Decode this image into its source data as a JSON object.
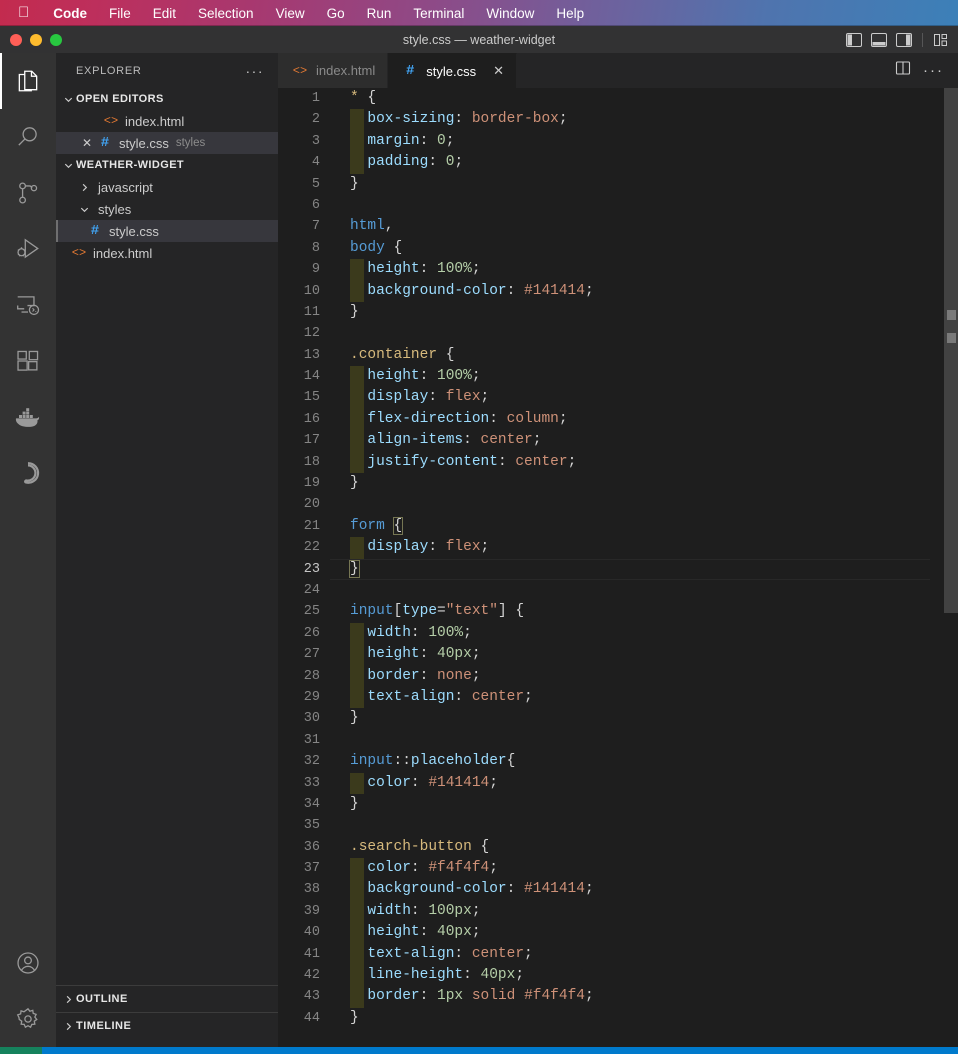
{
  "menubar": {
    "apple_logo": "",
    "items": [
      {
        "label": "Code",
        "bold": true
      },
      {
        "label": "File",
        "bold": false
      },
      {
        "label": "Edit",
        "bold": false
      },
      {
        "label": "Selection",
        "bold": false
      },
      {
        "label": "View",
        "bold": false
      },
      {
        "label": "Go",
        "bold": false
      },
      {
        "label": "Run",
        "bold": false
      },
      {
        "label": "Terminal",
        "bold": false
      },
      {
        "label": "Window",
        "bold": false
      },
      {
        "label": "Help",
        "bold": false
      }
    ]
  },
  "titlebar": {
    "title": "style.css — weather-widget",
    "layout_icons": [
      "toggle-primary-sidebar",
      "toggle-panel",
      "toggle-secondary-sidebar",
      "customize-layout"
    ]
  },
  "activitybar": {
    "items": [
      {
        "name": "explorer",
        "active": true
      },
      {
        "name": "search",
        "active": false
      },
      {
        "name": "source-control",
        "active": false
      },
      {
        "name": "run-and-debug",
        "active": false
      },
      {
        "name": "remote-explorer",
        "active": false
      },
      {
        "name": "extensions",
        "active": false
      },
      {
        "name": "docker",
        "active": false
      },
      {
        "name": "sourcery",
        "active": false
      }
    ],
    "bottom": [
      {
        "name": "accounts"
      },
      {
        "name": "manage-settings"
      }
    ]
  },
  "sidebar": {
    "header_label": "EXPLORER",
    "header_actions": "···",
    "open_editors": {
      "label": "OPEN EDITORS",
      "expanded": true,
      "items": [
        {
          "name": "index.html",
          "icon": "html-icon",
          "description": "",
          "selected": false,
          "show_close": false
        },
        {
          "name": "style.css",
          "icon": "css-icon",
          "description": "styles",
          "selected": true,
          "show_close": true
        }
      ]
    },
    "project": {
      "label": "WEATHER-WIDGET",
      "expanded": true,
      "items": [
        {
          "name": "javascript",
          "type": "folder",
          "expanded": false,
          "depth": 1,
          "selected": false
        },
        {
          "name": "styles",
          "type": "folder",
          "expanded": true,
          "depth": 1,
          "selected": false
        },
        {
          "name": "style.css",
          "type": "css",
          "depth": 2,
          "selected": true
        },
        {
          "name": "index.html",
          "type": "html",
          "depth": 1,
          "selected": false
        }
      ]
    },
    "bottom_panels": [
      {
        "label": "OUTLINE",
        "expanded": false
      },
      {
        "label": "TIMELINE",
        "expanded": false
      }
    ]
  },
  "tabs": [
    {
      "label": "index.html",
      "icon": "html-icon",
      "active": false,
      "show_close": false
    },
    {
      "label": "style.css",
      "icon": "css-icon",
      "active": true,
      "show_close": true
    }
  ],
  "tab_actions": [
    "split-editor-icon",
    "more-actions-icon"
  ],
  "editor": {
    "language": "css",
    "active_line": 23,
    "first_visible_line": 1,
    "lines": [
      {
        "n": 1,
        "indent": false,
        "tokens": [
          [
            "t-univ",
            "*"
          ],
          [
            "t-punc",
            " {"
          ]
        ]
      },
      {
        "n": 2,
        "indent": true,
        "tokens": [
          [
            "t-punc",
            "  "
          ],
          [
            "t-prop",
            "box-sizing"
          ],
          [
            "t-punc",
            ": "
          ],
          [
            "t-val",
            "border-box"
          ],
          [
            "t-punc",
            ";"
          ]
        ]
      },
      {
        "n": 3,
        "indent": true,
        "tokens": [
          [
            "t-punc",
            "  "
          ],
          [
            "t-prop",
            "margin"
          ],
          [
            "t-punc",
            ": "
          ],
          [
            "t-num",
            "0"
          ],
          [
            "t-punc",
            ";"
          ]
        ]
      },
      {
        "n": 4,
        "indent": true,
        "tokens": [
          [
            "t-punc",
            "  "
          ],
          [
            "t-prop",
            "padding"
          ],
          [
            "t-punc",
            ": "
          ],
          [
            "t-num",
            "0"
          ],
          [
            "t-punc",
            ";"
          ]
        ]
      },
      {
        "n": 5,
        "indent": false,
        "tokens": [
          [
            "t-punc",
            "}"
          ]
        ]
      },
      {
        "n": 6,
        "indent": false,
        "tokens": []
      },
      {
        "n": 7,
        "indent": false,
        "tokens": [
          [
            "t-tag",
            "html"
          ],
          [
            "t-punc",
            ","
          ]
        ]
      },
      {
        "n": 8,
        "indent": false,
        "tokens": [
          [
            "t-tag",
            "body"
          ],
          [
            "t-punc",
            " {"
          ]
        ]
      },
      {
        "n": 9,
        "indent": true,
        "tokens": [
          [
            "t-punc",
            "  "
          ],
          [
            "t-prop",
            "height"
          ],
          [
            "t-punc",
            ": "
          ],
          [
            "t-num",
            "100%"
          ],
          [
            "t-punc",
            ";"
          ]
        ]
      },
      {
        "n": 10,
        "indent": true,
        "tokens": [
          [
            "t-punc",
            "  "
          ],
          [
            "t-prop",
            "background-color"
          ],
          [
            "t-punc",
            ": "
          ],
          [
            "t-val",
            "#141414"
          ],
          [
            "t-punc",
            ";"
          ]
        ]
      },
      {
        "n": 11,
        "indent": false,
        "tokens": [
          [
            "t-punc",
            "}"
          ]
        ]
      },
      {
        "n": 12,
        "indent": false,
        "tokens": []
      },
      {
        "n": 13,
        "indent": false,
        "tokens": [
          [
            "t-sel",
            ".container"
          ],
          [
            "t-punc",
            " {"
          ]
        ]
      },
      {
        "n": 14,
        "indent": true,
        "tokens": [
          [
            "t-punc",
            "  "
          ],
          [
            "t-prop",
            "height"
          ],
          [
            "t-punc",
            ": "
          ],
          [
            "t-num",
            "100%"
          ],
          [
            "t-punc",
            ";"
          ]
        ]
      },
      {
        "n": 15,
        "indent": true,
        "tokens": [
          [
            "t-punc",
            "  "
          ],
          [
            "t-prop",
            "display"
          ],
          [
            "t-punc",
            ": "
          ],
          [
            "t-val",
            "flex"
          ],
          [
            "t-punc",
            ";"
          ]
        ]
      },
      {
        "n": 16,
        "indent": true,
        "tokens": [
          [
            "t-punc",
            "  "
          ],
          [
            "t-prop",
            "flex-direction"
          ],
          [
            "t-punc",
            ": "
          ],
          [
            "t-val",
            "column"
          ],
          [
            "t-punc",
            ";"
          ]
        ]
      },
      {
        "n": 17,
        "indent": true,
        "tokens": [
          [
            "t-punc",
            "  "
          ],
          [
            "t-prop",
            "align-items"
          ],
          [
            "t-punc",
            ": "
          ],
          [
            "t-val",
            "center"
          ],
          [
            "t-punc",
            ";"
          ]
        ]
      },
      {
        "n": 18,
        "indent": true,
        "tokens": [
          [
            "t-punc",
            "  "
          ],
          [
            "t-prop",
            "justify-content"
          ],
          [
            "t-punc",
            ": "
          ],
          [
            "t-val",
            "center"
          ],
          [
            "t-punc",
            ";"
          ]
        ]
      },
      {
        "n": 19,
        "indent": false,
        "tokens": [
          [
            "t-punc",
            "}"
          ]
        ]
      },
      {
        "n": 20,
        "indent": false,
        "tokens": []
      },
      {
        "n": 21,
        "indent": false,
        "tokens": [
          [
            "t-tag",
            "form"
          ],
          [
            "t-punc",
            " "
          ],
          [
            "bracket",
            "{"
          ]
        ]
      },
      {
        "n": 22,
        "indent": true,
        "tokens": [
          [
            "t-punc",
            "  "
          ],
          [
            "t-prop",
            "display"
          ],
          [
            "t-punc",
            ": "
          ],
          [
            "t-val",
            "flex"
          ],
          [
            "t-punc",
            ";"
          ]
        ]
      },
      {
        "n": 23,
        "indent": false,
        "tokens": [
          [
            "bracket",
            "}"
          ]
        ]
      },
      {
        "n": 24,
        "indent": false,
        "tokens": []
      },
      {
        "n": 25,
        "indent": false,
        "tokens": [
          [
            "t-tag",
            "input"
          ],
          [
            "t-punc",
            "["
          ],
          [
            "t-attr",
            "type"
          ],
          [
            "t-punc",
            "="
          ],
          [
            "t-val",
            "\"text\""
          ],
          [
            "t-punc",
            "] {"
          ]
        ]
      },
      {
        "n": 26,
        "indent": true,
        "tokens": [
          [
            "t-punc",
            "  "
          ],
          [
            "t-prop",
            "width"
          ],
          [
            "t-punc",
            ": "
          ],
          [
            "t-num",
            "100%"
          ],
          [
            "t-punc",
            ";"
          ]
        ]
      },
      {
        "n": 27,
        "indent": true,
        "tokens": [
          [
            "t-punc",
            "  "
          ],
          [
            "t-prop",
            "height"
          ],
          [
            "t-punc",
            ": "
          ],
          [
            "t-num",
            "40px"
          ],
          [
            "t-punc",
            ";"
          ]
        ]
      },
      {
        "n": 28,
        "indent": true,
        "tokens": [
          [
            "t-punc",
            "  "
          ],
          [
            "t-prop",
            "border"
          ],
          [
            "t-punc",
            ": "
          ],
          [
            "t-val",
            "none"
          ],
          [
            "t-punc",
            ";"
          ]
        ]
      },
      {
        "n": 29,
        "indent": true,
        "tokens": [
          [
            "t-punc",
            "  "
          ],
          [
            "t-prop",
            "text-align"
          ],
          [
            "t-punc",
            ": "
          ],
          [
            "t-val",
            "center"
          ],
          [
            "t-punc",
            ";"
          ]
        ]
      },
      {
        "n": 30,
        "indent": false,
        "tokens": [
          [
            "t-punc",
            "}"
          ]
        ]
      },
      {
        "n": 31,
        "indent": false,
        "tokens": []
      },
      {
        "n": 32,
        "indent": false,
        "tokens": [
          [
            "t-tag",
            "input"
          ],
          [
            "t-punc",
            "::"
          ],
          [
            "t-prop",
            "placeholder"
          ],
          [
            "t-punc",
            "{"
          ]
        ]
      },
      {
        "n": 33,
        "indent": true,
        "tokens": [
          [
            "t-punc",
            "  "
          ],
          [
            "t-prop",
            "color"
          ],
          [
            "t-punc",
            ": "
          ],
          [
            "t-val",
            "#141414"
          ],
          [
            "t-punc",
            ";"
          ]
        ]
      },
      {
        "n": 34,
        "indent": false,
        "tokens": [
          [
            "t-punc",
            "}"
          ]
        ]
      },
      {
        "n": 35,
        "indent": false,
        "tokens": []
      },
      {
        "n": 36,
        "indent": false,
        "tokens": [
          [
            "t-sel",
            ".search-button"
          ],
          [
            "t-punc",
            " {"
          ]
        ]
      },
      {
        "n": 37,
        "indent": true,
        "tokens": [
          [
            "t-punc",
            "  "
          ],
          [
            "t-prop",
            "color"
          ],
          [
            "t-punc",
            ": "
          ],
          [
            "t-val",
            "#f4f4f4"
          ],
          [
            "t-punc",
            ";"
          ]
        ]
      },
      {
        "n": 38,
        "indent": true,
        "tokens": [
          [
            "t-punc",
            "  "
          ],
          [
            "t-prop",
            "background-color"
          ],
          [
            "t-punc",
            ": "
          ],
          [
            "t-val",
            "#141414"
          ],
          [
            "t-punc",
            ";"
          ]
        ]
      },
      {
        "n": 39,
        "indent": true,
        "tokens": [
          [
            "t-punc",
            "  "
          ],
          [
            "t-prop",
            "width"
          ],
          [
            "t-punc",
            ": "
          ],
          [
            "t-num",
            "100px"
          ],
          [
            "t-punc",
            ";"
          ]
        ]
      },
      {
        "n": 40,
        "indent": true,
        "tokens": [
          [
            "t-punc",
            "  "
          ],
          [
            "t-prop",
            "height"
          ],
          [
            "t-punc",
            ": "
          ],
          [
            "t-num",
            "40px"
          ],
          [
            "t-punc",
            ";"
          ]
        ]
      },
      {
        "n": 41,
        "indent": true,
        "tokens": [
          [
            "t-punc",
            "  "
          ],
          [
            "t-prop",
            "text-align"
          ],
          [
            "t-punc",
            ": "
          ],
          [
            "t-val",
            "center"
          ],
          [
            "t-punc",
            ";"
          ]
        ]
      },
      {
        "n": 42,
        "indent": true,
        "tokens": [
          [
            "t-punc",
            "  "
          ],
          [
            "t-prop",
            "line-height"
          ],
          [
            "t-punc",
            ": "
          ],
          [
            "t-num",
            "40px"
          ],
          [
            "t-punc",
            ";"
          ]
        ]
      },
      {
        "n": 43,
        "indent": true,
        "tokens": [
          [
            "t-punc",
            "  "
          ],
          [
            "t-prop",
            "border"
          ],
          [
            "t-punc",
            ": "
          ],
          [
            "t-num",
            "1px"
          ],
          [
            "t-punc",
            " "
          ],
          [
            "t-val",
            "solid"
          ],
          [
            "t-punc",
            " "
          ],
          [
            "t-val",
            "#f4f4f4"
          ],
          [
            "t-punc",
            ";"
          ]
        ]
      },
      {
        "n": 44,
        "indent": false,
        "tokens": [
          [
            "t-punc",
            "}"
          ]
        ]
      }
    ]
  },
  "colors": {
    "menubar_left": "#c32b4e",
    "menubar_right": "#3c80b8",
    "titlebar_bg": "#323233",
    "activitybar_bg": "#333333",
    "sidebar_bg": "#252526",
    "editor_bg": "#1e1e1e",
    "tab_active_bg": "#1e1e1e",
    "tab_inactive_bg": "#2d2d2d",
    "statusbar_bg": "#007acc",
    "remote_badge_bg": "#16825d",
    "selection_bg": "#37373d",
    "indent_highlight": "#3b3a1c",
    "css_icon": "#42a5f5",
    "html_icon": "#e37933"
  }
}
